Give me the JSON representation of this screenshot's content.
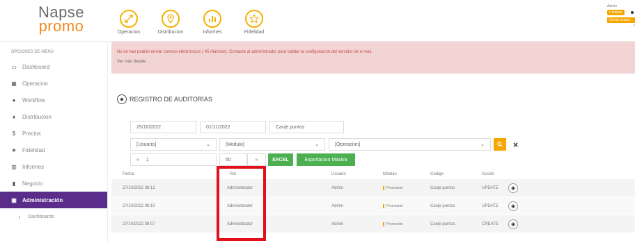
{
  "header": {
    "logo_line1": "Napse",
    "logo_line2": "promo",
    "nav": [
      {
        "label": "Operacion",
        "icon": "arrows-icon"
      },
      {
        "label": "Distribucion",
        "icon": "location-pin-icon"
      },
      {
        "label": "Informes",
        "icon": "bar-chart-icon"
      },
      {
        "label": "Fidelidad",
        "icon": "star-icon"
      }
    ],
    "user_label": "Admin",
    "badge": "Cambiar",
    "badge2": "Cerrar sesion",
    "extra": "...?"
  },
  "sidebar": {
    "title": "OPCIONES DE MENÚ",
    "items": [
      {
        "label": "Dashboard",
        "icon": "monitor-icon"
      },
      {
        "label": "Operacion",
        "icon": "grid-icon"
      },
      {
        "label": "Workflow",
        "icon": "pin-icon"
      },
      {
        "label": "Distribucion",
        "icon": "location-icon"
      },
      {
        "label": "Precios",
        "icon": "dollar-icon"
      },
      {
        "label": "Fidelidad",
        "icon": "star-icon"
      },
      {
        "label": "Informes",
        "icon": "chart-icon"
      },
      {
        "label": "Negocio",
        "icon": "building-icon"
      },
      {
        "label": "Administración",
        "icon": "calendar-icon"
      },
      {
        "label": "Dashboards",
        "icon": "sub-icon"
      }
    ]
  },
  "alert": {
    "message": "No se han podido enviar correos electrónicos ( 45 Alarmas). Contacte al administrador para validar la configuración del servidor de e-mail.",
    "more": "Ver más detalle"
  },
  "page": {
    "title": "REGISTRO DE AUDITORÍAS"
  },
  "filters": {
    "date_from": "25/10/2022",
    "date_to": "01/11/2022",
    "text": "Canje puntos",
    "usuario": "[Usuario]",
    "modulo": "[Modulo]",
    "operacion": "[Operacion]",
    "page": "1",
    "page_size": "50",
    "first_icon": "«",
    "next_icon": "»",
    "excel": "EXCEL",
    "export": "Exportacion Masiva",
    "search_icon": "search-icon",
    "clear_icon": "close-icon"
  },
  "table": {
    "headers": [
      "Fecha",
      "Rol",
      "Usuario",
      "Módulo",
      "Código",
      "Acción"
    ],
    "rows": [
      {
        "fecha": "27/10/2022 08:12",
        "rol": "Administrador",
        "usuario": "Admin",
        "modulo": "Promoción",
        "codigo": "Canje puntos",
        "accion": "UPDATE"
      },
      {
        "fecha": "27/10/2022 08:10",
        "rol": "Administrador",
        "usuario": "Admin",
        "modulo": "Promoción",
        "codigo": "Canje puntos",
        "accion": "UPDATE"
      },
      {
        "fecha": "27/10/2022 08:07",
        "rol": "Administrador",
        "usuario": "Admin",
        "modulo": "Promoción",
        "codigo": "Canje puntos",
        "accion": "CREATE"
      }
    ]
  },
  "colors": {
    "accent": "#f5a700",
    "sidebar_active": "#5b2d8a",
    "alert_bg": "#f3d4d4",
    "excel_green": "#4caf50",
    "highlight": "#e0111b"
  }
}
